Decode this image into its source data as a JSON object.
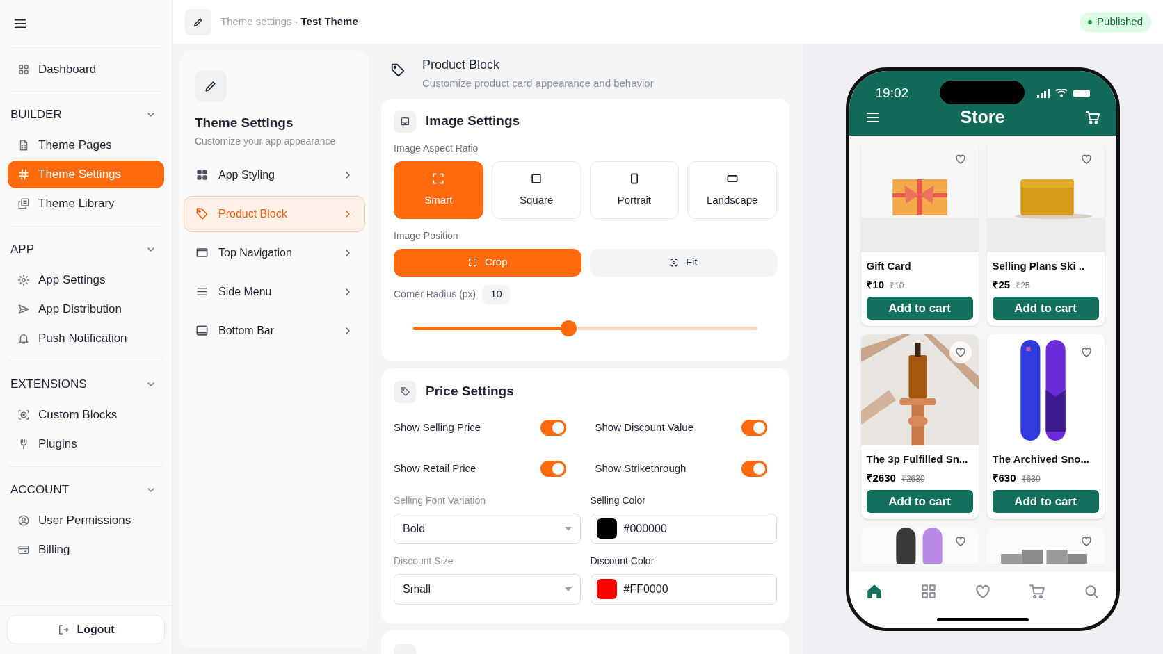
{
  "sidebar": {
    "top_item": {
      "label": "Dashboard",
      "selected": false
    },
    "sections": [
      {
        "title": "BUILDER",
        "expanded": true,
        "items": [
          {
            "label": "Theme Pages",
            "selected": false
          },
          {
            "label": "Theme Settings",
            "selected": true
          },
          {
            "label": "Theme Library",
            "selected": false
          }
        ]
      },
      {
        "title": "APP",
        "expanded": true,
        "items": [
          {
            "label": "App Settings",
            "selected": false
          },
          {
            "label": "App Distribution",
            "selected": false
          },
          {
            "label": "Push Notification",
            "selected": false
          }
        ]
      },
      {
        "title": "EXTENSIONS",
        "expanded": true,
        "items": [
          {
            "label": "Custom Blocks",
            "selected": false
          },
          {
            "label": "Plugins",
            "selected": false
          }
        ]
      },
      {
        "title": "ACCOUNT",
        "expanded": true,
        "items": [
          {
            "label": "User Permissions",
            "selected": false
          },
          {
            "label": "Billing",
            "selected": false
          }
        ]
      }
    ],
    "logout": "Logout"
  },
  "header": {
    "breadcrumb_parent": "Theme settings",
    "separator": "·",
    "breadcrumb_current": "Test Theme",
    "status": "Published"
  },
  "settings_menu": {
    "title": "Theme Settings",
    "subtitle": "Customize your app appearance",
    "items": [
      {
        "label": "App Styling",
        "selected": false
      },
      {
        "label": "Product Block",
        "selected": true
      },
      {
        "label": "Top Navigation",
        "selected": false
      },
      {
        "label": "Side Menu",
        "selected": false
      },
      {
        "label": "Bottom Bar",
        "selected": false
      }
    ]
  },
  "section_header": {
    "title": "Product Block",
    "subtitle": "Customize product card appearance and behavior"
  },
  "image_settings": {
    "title": "Image Settings",
    "aspect_label": "Image Aspect Ratio",
    "aspect_options": [
      {
        "label": "Smart",
        "selected": true
      },
      {
        "label": "Square",
        "selected": false
      },
      {
        "label": "Portrait",
        "selected": false
      },
      {
        "label": "Landscape",
        "selected": false
      }
    ],
    "position_label": "Image Position",
    "position_options": [
      {
        "label": "Crop",
        "selected": true
      },
      {
        "label": "Fit",
        "selected": false
      }
    ],
    "radius_label": "Corner Radius (px)",
    "radius_value": "10",
    "radius_slider": {
      "level": 0.45
    }
  },
  "price_settings": {
    "title": "Price Settings",
    "toggles": [
      {
        "label": "Show Selling Price",
        "on": true
      },
      {
        "label": "Show Discount Value",
        "on": true
      },
      {
        "label": "Show Retail Price",
        "on": true
      },
      {
        "label": "Show Strikethrough",
        "on": true
      }
    ],
    "fields": [
      {
        "kind": "select",
        "label": "Selling Font Variation",
        "value": "Bold"
      },
      {
        "kind": "color",
        "label": "Selling Color",
        "value": "#000000",
        "color": "#000000"
      },
      {
        "kind": "select",
        "label": "Discount Size",
        "value": "Small"
      },
      {
        "kind": "color",
        "label": "Discount Color",
        "value": "#FF0000",
        "color": "#ff0000"
      }
    ]
  },
  "preview": {
    "time": "19:02",
    "title": "Store",
    "products": [
      {
        "name": "Gift Card",
        "price": "₹10",
        "old_price": "₹10",
        "button": "Add to cart"
      },
      {
        "name": "Selling Plans Ski ..",
        "price": "₹25",
        "old_price": "₹25",
        "button": "Add to cart"
      },
      {
        "name": "The 3p Fulfilled Sn...",
        "price": "₹2630",
        "old_price": "₹2630",
        "button": "Add to cart"
      },
      {
        "name": "The Archived Sno...",
        "price": "₹630",
        "old_price": "₹630",
        "button": "Add to cart"
      }
    ],
    "nav": [
      {
        "selected": true
      },
      {
        "selected": false
      },
      {
        "selected": false
      },
      {
        "selected": false
      },
      {
        "selected": false
      }
    ]
  }
}
